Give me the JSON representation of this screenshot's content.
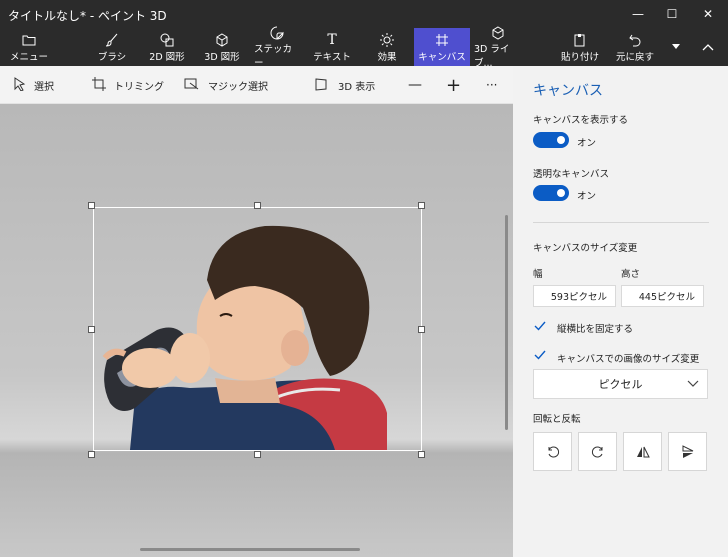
{
  "window": {
    "title": "タイトルなし* - ペイント 3D",
    "minimize": "—",
    "maximize": "☐",
    "close": "✕"
  },
  "ribbon": {
    "menu": "メニュー",
    "brush": "ブラシ",
    "shapes2d": "2D 図形",
    "shapes3d": "3D 図形",
    "stickers": "ステッカー",
    "text": "テキスト",
    "effects": "効果",
    "canvas": "キャンバス",
    "library3d": "3D ライブ...",
    "paste": "貼り付け",
    "undo": "元に戻す",
    "active_tab": "canvas"
  },
  "toolbar": {
    "select": "選択",
    "crop": "トリミング",
    "magic_select": "マジック選択",
    "view3d": "3D 表示",
    "zoom_out": "—",
    "zoom_in": "+",
    "more": "···"
  },
  "panel": {
    "title": "キャンバス",
    "show_canvas_label": "キャンバスを表示する",
    "show_canvas_state": "オン",
    "show_canvas_on": true,
    "transparent_label": "透明なキャンバス",
    "transparent_state": "オン",
    "transparent_on": true,
    "resize_heading": "キャンバスのサイズ変更",
    "width_label": "幅",
    "height_label": "高さ",
    "width_value": "593ピクセル",
    "height_value": "445ピクセル",
    "lock_aspect_label": "縦横比を固定する",
    "lock_aspect_checked": true,
    "resize_image_label": "キャンバスでの画像のサイズ変更",
    "resize_image_checked": true,
    "unit_select": "ピクセル",
    "rotate_heading": "回転と反転"
  },
  "colors": {
    "accent_active": "#4f4fcf",
    "toggle_on": "#0b5cc5",
    "panel_title": "#1a5fb4",
    "titlebar_bg": "#2b2b2b"
  }
}
